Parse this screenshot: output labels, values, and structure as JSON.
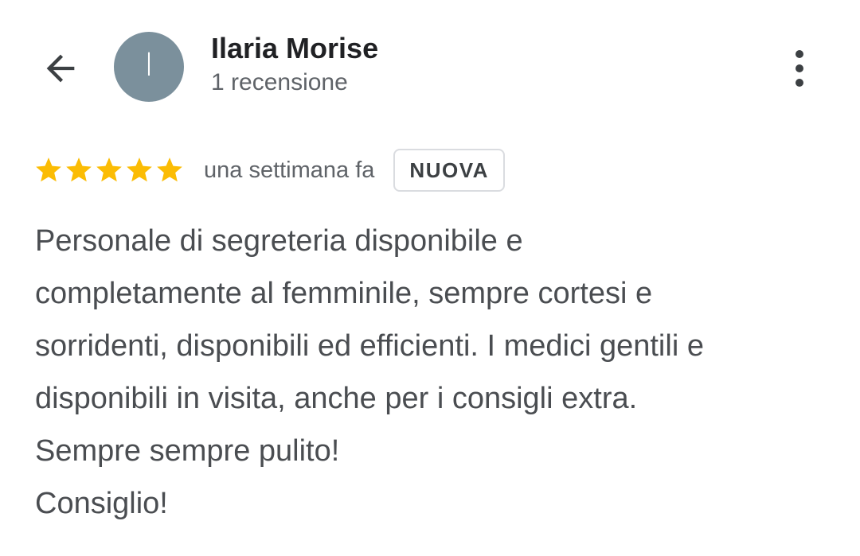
{
  "header": {
    "back_icon": "arrow-back-icon",
    "avatar_letter": "I",
    "avatar_color": "#7b909c",
    "user_name": "Ilaria Morise",
    "review_count": "1 recensione",
    "more_icon": "more-vert-icon"
  },
  "review": {
    "rating": 5,
    "rating_max": 5,
    "star_color": "#fbbc04",
    "time_ago": "una settimana fa",
    "badge": "NUOVA",
    "text_lines": [
      "Personale di segreteria disponibile e",
      "completamente al femminile, sempre cortesi e",
      "sorridenti, disponibili ed efficienti. I medici gentili e",
      "disponibili in visita, anche per i consigli extra.",
      "Sempre sempre pulito!",
      "Consiglio!"
    ]
  }
}
